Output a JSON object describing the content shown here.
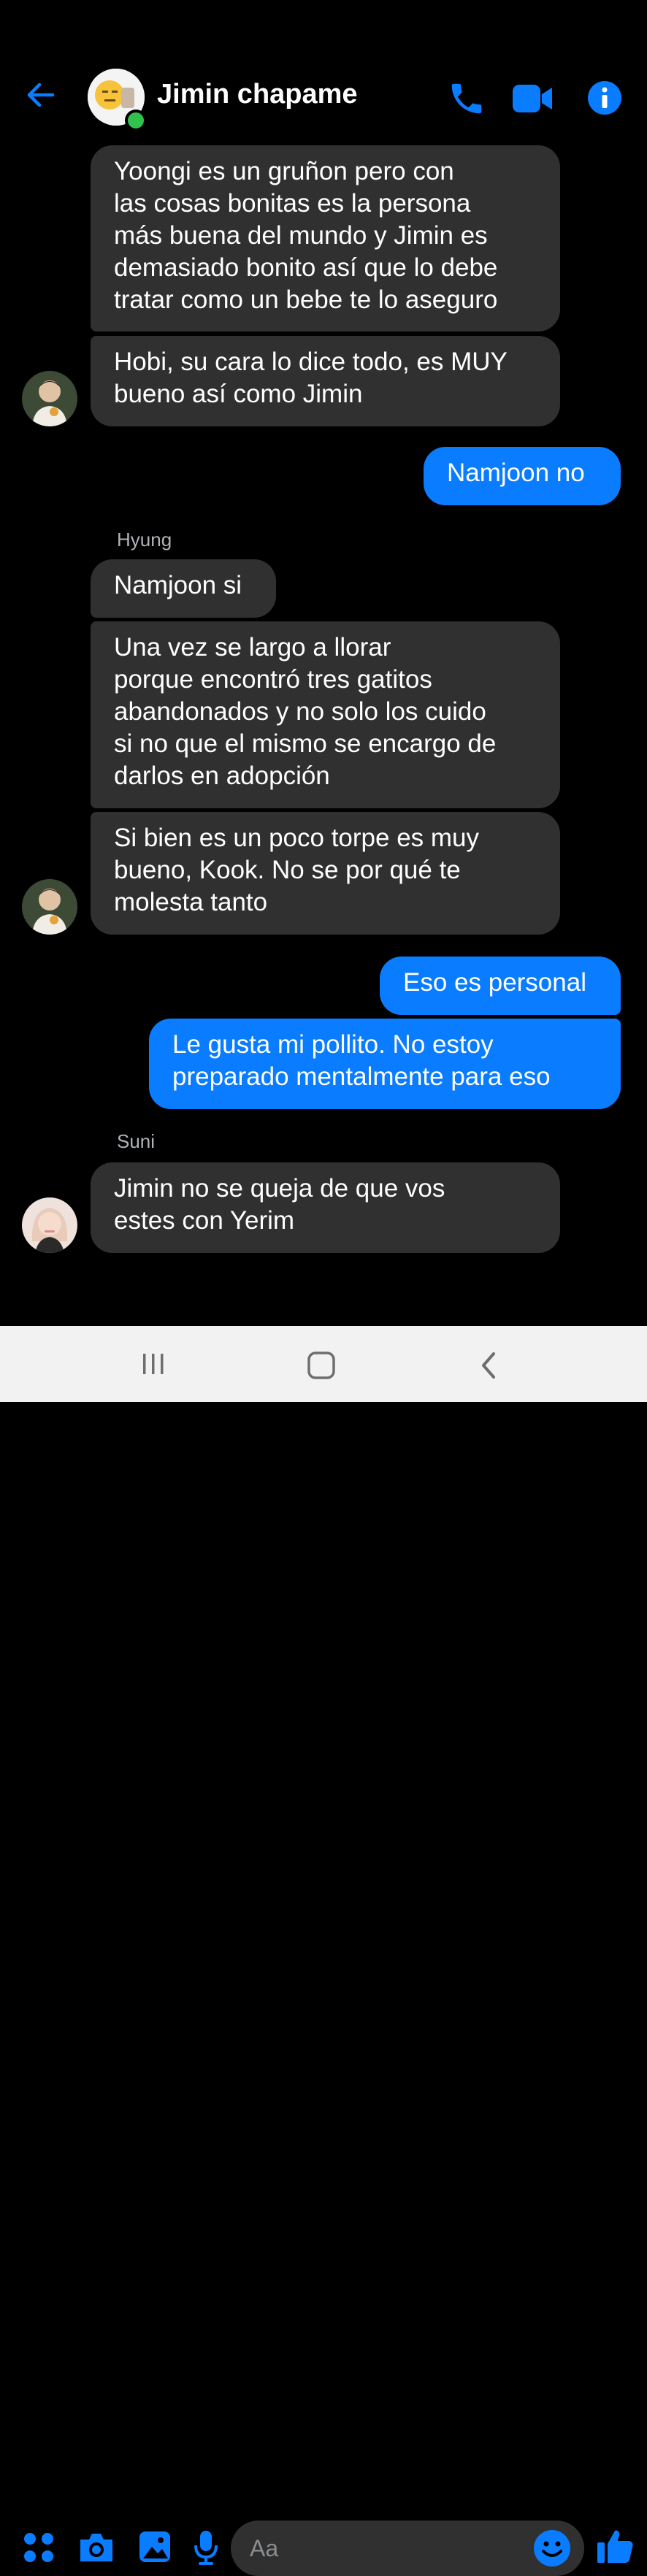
{
  "header": {
    "title": "Jimin chapame",
    "back_icon": "arrow-left-icon",
    "call_icon": "phone-icon",
    "video_icon": "video-camera-icon",
    "info_icon": "info-icon",
    "accent": "#0a7cff",
    "online_color": "#31c24d"
  },
  "messages": [
    {
      "text": "Yoongi es un gruñon pero con\nlas cosas bonitas es la persona\nmás buena del mundo y Jimin es\ndemasiado bonito así que lo debe\ntratar como un bebe te lo aseguro"
    },
    {
      "text": "Hobi, su cara lo dice todo, es MUY\nbueno así como Jimin"
    },
    {
      "text": "Namjoon no"
    },
    {
      "sender": "Hyung"
    },
    {
      "text": "Namjoon si"
    },
    {
      "text": "Una vez se largo a llorar\nporque encontró tres gatitos\nabandonados y no solo los cuido\nsi no que el mismo se encargo de\ndarlos en adopción"
    },
    {
      "text": "Si bien es un poco torpe es muy\nbueno, Kook. No se por qué te\nmolesta tanto"
    },
    {
      "text": "Eso es personal"
    },
    {
      "text": "Le gusta mi pollito. No estoy\npreparado mentalmente para eso"
    },
    {
      "sender": "Suni"
    },
    {
      "text": "Jimin no se queja de que vos\nestes con Yerim"
    }
  ],
  "composer": {
    "placeholder": "Aa",
    "icons": [
      "apps-grid-icon",
      "camera-icon",
      "image-icon",
      "microphone-icon",
      "emoji-icon",
      "thumbs-up-icon"
    ]
  },
  "navbar": {
    "icons": [
      "recent-apps-icon",
      "home-icon",
      "back-icon"
    ]
  },
  "colors": {
    "incoming_bubble": "#303030",
    "outgoing_bubble": "#0a7cff",
    "background": "#000000"
  }
}
